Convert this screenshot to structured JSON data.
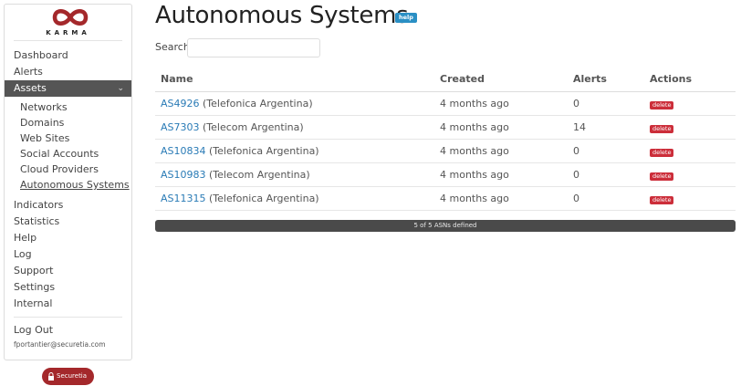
{
  "brand": {
    "logo_text": "KARMA"
  },
  "sidebar": {
    "items": [
      {
        "label": "Dashboard"
      },
      {
        "label": "Alerts"
      },
      {
        "label": "Assets",
        "active": true
      }
    ],
    "sub_items": [
      {
        "label": "Networks"
      },
      {
        "label": "Domains"
      },
      {
        "label": "Web Sites"
      },
      {
        "label": "Social Accounts"
      },
      {
        "label": "Cloud Providers"
      },
      {
        "label": "Autonomous Systems",
        "current": true
      }
    ],
    "items_after": [
      {
        "label": "Indicators"
      },
      {
        "label": "Statistics"
      },
      {
        "label": "Help"
      },
      {
        "label": "Log"
      },
      {
        "label": "Support"
      },
      {
        "label": "Settings"
      },
      {
        "label": "Internal"
      }
    ],
    "logout": "Log Out",
    "user_email": "fportantier@securetia.com"
  },
  "badge": {
    "label": "Securetia"
  },
  "page": {
    "title": "Autonomous Systems",
    "help_label": "help",
    "search_label": "Search:",
    "search_value": "",
    "search_placeholder": ""
  },
  "table": {
    "headers": {
      "name": "Name",
      "created": "Created",
      "alerts": "Alerts",
      "actions": "Actions"
    },
    "delete_label": "delete",
    "rows": [
      {
        "asn": "AS4926",
        "org": "(Telefonica Argentina)",
        "created": "4 months ago",
        "alerts": "0"
      },
      {
        "asn": "AS7303",
        "org": "(Telecom Argentina)",
        "created": "4 months ago",
        "alerts": "14"
      },
      {
        "asn": "AS10834",
        "org": "(Telefonica Argentina)",
        "created": "4 months ago",
        "alerts": "0"
      },
      {
        "asn": "AS10983",
        "org": "(Telecom Argentina)",
        "created": "4 months ago",
        "alerts": "0"
      },
      {
        "asn": "AS11315",
        "org": "(Telefonica Argentina)",
        "created": "4 months ago",
        "alerts": "0"
      }
    ],
    "footer": "5 of 5 ASNs defined"
  },
  "colors": {
    "brand_red": "#a4282b",
    "link_blue": "#2a7bb6",
    "delete_red": "#cc2e3a",
    "help_blue": "#2a8fc4",
    "active_nav": "#555555"
  }
}
